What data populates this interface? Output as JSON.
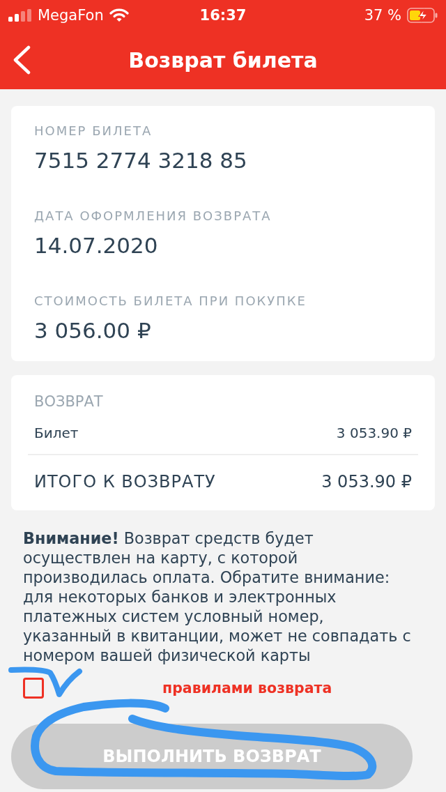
{
  "status_bar": {
    "carrier": "MegaFon",
    "time": "16:37",
    "battery": "37 %"
  },
  "nav": {
    "title": "Возврат билета"
  },
  "ticket_card": {
    "fields": [
      {
        "label": "НОМЕР БИЛЕТА",
        "value": "7515 2774 3218 85"
      },
      {
        "label": "ДАТА ОФОРМЛЕНИЯ ВОЗВРАТА",
        "value": "14.07.2020"
      },
      {
        "label": "СТОИМОСТЬ БИЛЕТА ПРИ ПОКУПКЕ",
        "value": "3 056.00 ₽"
      }
    ]
  },
  "refund_card": {
    "title": "ВОЗВРАТ",
    "lines": [
      {
        "label": "Билет",
        "amount": "3 053.90 ₽"
      }
    ],
    "total": {
      "label": "ИТОГО К ВОЗВРАТУ",
      "amount": "3 053.90 ₽"
    }
  },
  "notice": "**Внимание!** Возврат средств будет осуществлен на карту, с которой производилась оплата. Обратите внимание: для некоторых банков и электронных платежных систем условный номер, указанный в квитанции, может не совпадать с номером вашей физической карты",
  "agreement": {
    "checked": false,
    "link": "правилами возврата"
  },
  "submit_button": {
    "label": "ВЫПОЛНИТЬ ВОЗВРАТ",
    "disabled": true
  }
}
